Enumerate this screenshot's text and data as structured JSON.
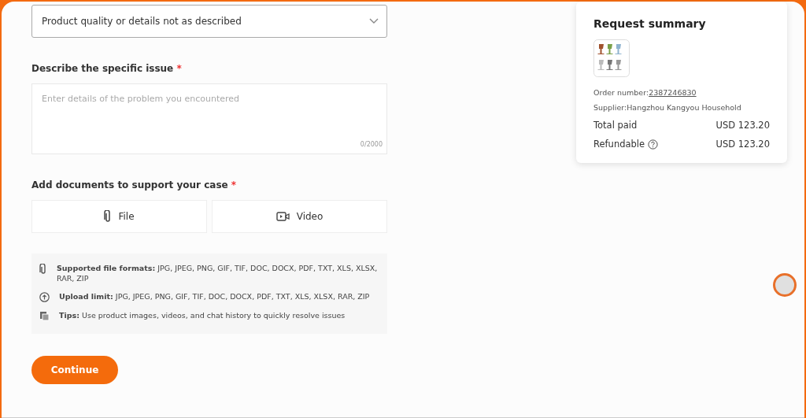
{
  "reason_select": {
    "value": "Product quality or details not as described"
  },
  "issue": {
    "label": "Describe the specific issue",
    "required_mark": "*",
    "placeholder": "Enter details of the problem you encountered",
    "counter": "0/2000"
  },
  "documents": {
    "label": "Add documents to support your case",
    "required_mark": "*",
    "options": [
      {
        "kind": "file",
        "label": "File"
      },
      {
        "kind": "video",
        "label": "Video"
      }
    ]
  },
  "tips": [
    {
      "kind": "clip",
      "text": "**Supported file formats:** JPG, JPEG, PNG, GIF, TIF, DOC, DOCX, PDF, TXT, XLS, XLSX, RAR, ZIP"
    },
    {
      "kind": "upload",
      "text": "**Upload limit:** JPG, JPEG, PNG, GIF, TIF, DOC, DOCX, PDF, TXT, XLS, XLSX, RAR, ZIP"
    },
    {
      "kind": "copy",
      "text": "**Tips:** Use product images, videos, and chat history to quickly resolve issues"
    }
  ],
  "continue_button": "Continue",
  "summary": {
    "title": "Request summary",
    "order_label": "Order number:",
    "order_number": "2387246830",
    "supplier": "Supplier:Hangzhou Kangyou Household",
    "rows": [
      {
        "label": "Total paid",
        "value": "USD 123.20",
        "help": false
      },
      {
        "label": "Refundable",
        "value": "USD 123.20",
        "help": true
      }
    ]
  }
}
